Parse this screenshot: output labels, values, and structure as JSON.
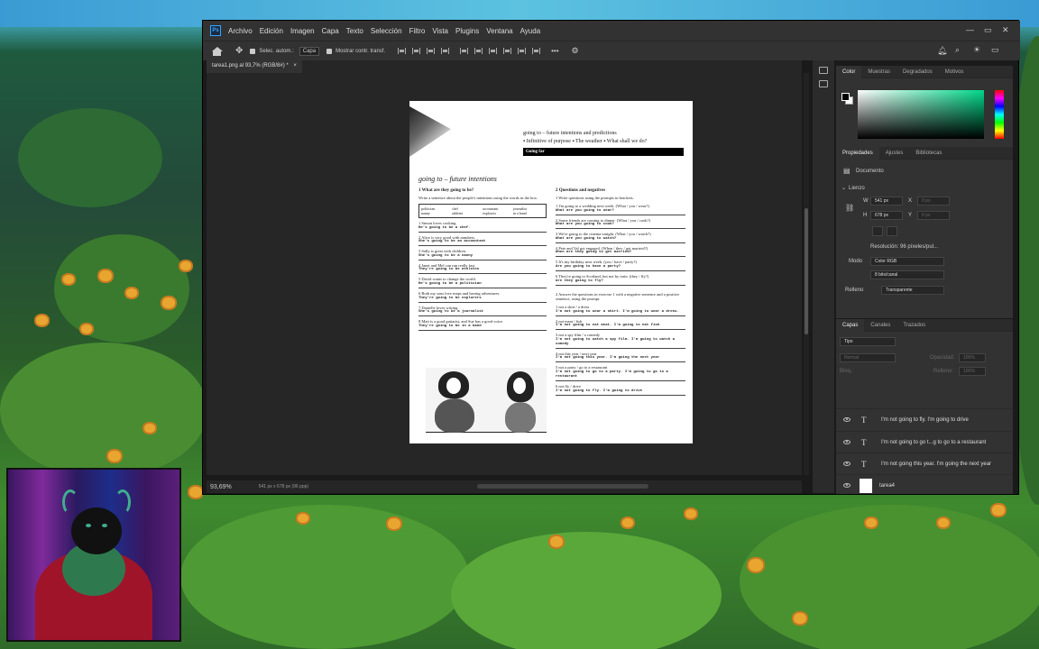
{
  "app": {
    "logo": "Ps",
    "menu": [
      "Archivo",
      "Edición",
      "Imagen",
      "Capa",
      "Texto",
      "Selección",
      "Filtro",
      "Vista",
      "Plugins",
      "Ventana",
      "Ayuda"
    ],
    "window_controls": [
      "—",
      "▭",
      "✕"
    ]
  },
  "options_bar": {
    "auto_select_label": "Selec. autom.:",
    "layer_select": "Capa",
    "show_transform_label": "Mostrar contr. transf.",
    "more": "•••"
  },
  "document": {
    "tab_title": "tarea1.png al 93,7% (RGB/8#) *",
    "zoom": "93,69%",
    "info": "541 px x 678 px (96 ppp)"
  },
  "worksheet": {
    "header1": "going to – future intentions and predictions",
    "header2": "▪ Infinitive of purpose   ▪ The weather   ▪ What shall we do?",
    "bar": "Going far",
    "title": "going to – future intentions",
    "ex1": {
      "heading": "1  What are they going to be?",
      "instruction": "Write a sentence about the people's intentions using the words in the box.",
      "words": [
        "politician",
        "chef",
        "accountant",
        "journalist",
        "nanny",
        "athletes",
        "explorers",
        "in a band"
      ],
      "items": [
        {
          "q": "1  Simon loves cooking.",
          "a": "He's going to be a chef."
        },
        {
          "q": "2  Alice is very good with numbers.",
          "a": "She's going to be an accountant"
        },
        {
          "q": "3  Sally is great with children.",
          "a": "She's going to be a nanny"
        },
        {
          "q": "4  Janet and Mel can run really fast.",
          "a": "They're going to be athletes"
        },
        {
          "q": "5  David wants to change the world.",
          "a": "He's going to be a politician"
        },
        {
          "q": "6  Both my sons love maps and having adventures.",
          "a": "They're going to be explorers"
        },
        {
          "q": "7  Danielle loves writing.",
          "a": "She's going to be a journalist"
        },
        {
          "q": "8  Matt is a good guitarist, and Sue has a good voice.",
          "a": "They're going to be in a band"
        }
      ]
    },
    "ex2": {
      "heading": "2  Questions and negatives",
      "instruction": "1  Write questions using the prompts in brackets.",
      "items": [
        {
          "q": "1  I'm going to a wedding next week. (What / you / wear?)",
          "a": "What are you going to wear?"
        },
        {
          "q": "2  Some friends are coming to dinner. (What / you / cook?)",
          "a": "What are you going to cook?"
        },
        {
          "q": "3  We're going to the cinema tonight. (What / you / watch?)",
          "a": "What are you going to watch?"
        },
        {
          "q": "4  Pete and Val got engaged. (When / they / get married?)",
          "a": "When are they going to get married?"
        },
        {
          "q": "5  It's my birthday next week. (you / have / party?)",
          "a": "Are you going to have a party?"
        },
        {
          "q": "6  They're going to Scotland, but not by train. (they / fly?)",
          "a": "Are they going to fly?"
        }
      ],
      "instruction2": "2  Answer the questions in exercise 1 with a negative sentence and a positive sentence, using the prompt.",
      "items2": [
        {
          "q": "1  not a shirt / a dress",
          "a": "I'm not going to wear a shirt. I'm going to wear a dress."
        },
        {
          "q": "2  not meat / fish",
          "a": "I'm not going to eat meat. I'm going to eat fish"
        },
        {
          "q": "3  not a spy film / a comedy",
          "a": "I'm not going to watch a spy film. I'm going to watch a comedy"
        },
        {
          "q": "4  not this year / next year",
          "a": "I'm not going this year. I'm going the next year"
        },
        {
          "q": "5  not a party / go to a restaurant",
          "a": "I'm not going to go to a party. I'm going to go to a restaurant"
        },
        {
          "q": "6  not fly / drive",
          "a": "I'm not going to fly. I'm going to drive"
        }
      ]
    }
  },
  "color_panel": {
    "tabs": [
      "Color",
      "Muestras",
      "Degradados",
      "Motivos"
    ],
    "active": "Color",
    "field_color": "#00d88a"
  },
  "properties_panel": {
    "tabs": [
      "Propiedades",
      "Ajustes",
      "Bibliotecas"
    ],
    "section_doc": "Documento",
    "section_canvas": "Lienzo",
    "w_label": "W",
    "w_value": "541 px",
    "x_label": "X",
    "x_placeholder": "0 px",
    "h_label": "H",
    "h_value": "678 px",
    "y_label": "Y",
    "y_placeholder": "0 px",
    "resolution": "Resolución: 96 píxeles/pul...",
    "mode_label": "Modo",
    "mode_value": "Color RGB",
    "depth_value": "8 bits/canal",
    "fill_label": "Relleno",
    "fill_value": "Transparente"
  },
  "layers_panel": {
    "tabs": [
      "Capas",
      "Canales",
      "Trazados"
    ],
    "filter": "Tipo",
    "blend": "Normal",
    "opacity_label": "Opacidad:",
    "opacity_value": "100%",
    "lock_label": "Bloq.:",
    "fill_label": "Relleno:",
    "fill_value": "100%",
    "layers": [
      {
        "kind": "text",
        "name": "I'm not going to fly. I'm going to drive"
      },
      {
        "kind": "text",
        "name": "I'm not going to go t...g to go to a restaurant"
      },
      {
        "kind": "text",
        "name": "I'm not going this year. I'm going the next year"
      },
      {
        "kind": "image",
        "name": "tarea4"
      }
    ]
  }
}
